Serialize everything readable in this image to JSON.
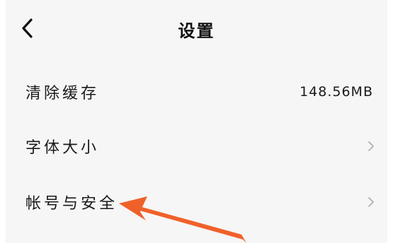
{
  "header": {
    "title": "设置",
    "back_icon": "chevron-left-icon"
  },
  "settings": {
    "items": [
      {
        "label": "清除缓存",
        "value": "148.56MB"
      },
      {
        "label": "字体大小",
        "icon": "chevron-right-icon"
      },
      {
        "label": "帐号与安全",
        "icon": "chevron-right-icon"
      }
    ]
  },
  "annotation": {
    "arrow_color": "#f0612a"
  }
}
